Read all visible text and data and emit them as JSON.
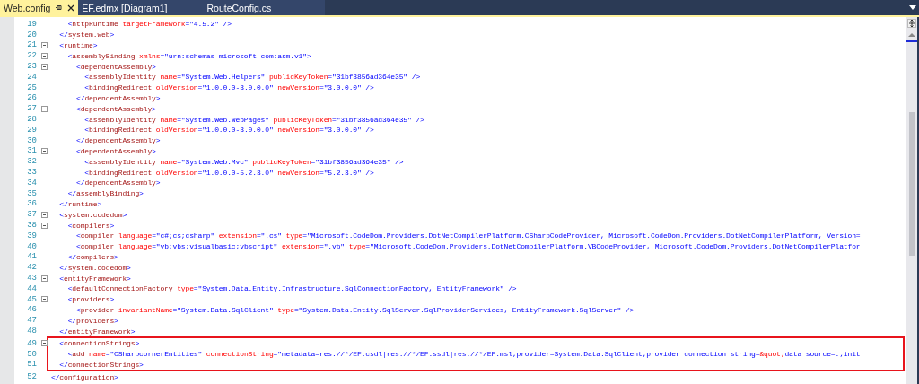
{
  "tabs": [
    {
      "label": "Web.config",
      "selected": true
    },
    {
      "label": "EF.edmx [Diagram1]",
      "selected": false
    },
    {
      "label": "RouteConfig.cs",
      "selected": false
    }
  ],
  "editor": {
    "lines": [
      {
        "number": "19",
        "fold": false,
        "highlighted": false,
        "tokens": [
          {
            "kind": "punct",
            "text": "    <"
          },
          {
            "kind": "elem",
            "text": "httpRuntime"
          },
          {
            "kind": "attr",
            "text": " targetFramework"
          },
          {
            "kind": "value",
            "text": "=\"4.5.2\""
          },
          {
            "kind": "punct",
            "text": " />"
          }
        ]
      },
      {
        "number": "20",
        "fold": false,
        "highlighted": false,
        "tokens": [
          {
            "kind": "punct",
            "text": "  </"
          },
          {
            "kind": "elem",
            "text": "system.web"
          },
          {
            "kind": "punct",
            "text": ">"
          }
        ]
      },
      {
        "number": "21",
        "fold": true,
        "highlighted": false,
        "tokens": [
          {
            "kind": "punct",
            "text": "  <"
          },
          {
            "kind": "elem",
            "text": "runtime"
          },
          {
            "kind": "punct",
            "text": ">"
          }
        ]
      },
      {
        "number": "22",
        "fold": true,
        "highlighted": false,
        "tokens": [
          {
            "kind": "punct",
            "text": "    <"
          },
          {
            "kind": "elem",
            "text": "assemblyBinding"
          },
          {
            "kind": "attr",
            "text": " xmlns"
          },
          {
            "kind": "value",
            "text": "=\"urn:schemas-microsoft-com:asm.v1\""
          },
          {
            "kind": "punct",
            "text": ">"
          }
        ]
      },
      {
        "number": "23",
        "fold": true,
        "highlighted": false,
        "tokens": [
          {
            "kind": "punct",
            "text": "      <"
          },
          {
            "kind": "elem",
            "text": "dependentAssembly"
          },
          {
            "kind": "punct",
            "text": ">"
          }
        ]
      },
      {
        "number": "24",
        "fold": false,
        "highlighted": false,
        "tokens": [
          {
            "kind": "punct",
            "text": "        <"
          },
          {
            "kind": "elem",
            "text": "assemblyIdentity"
          },
          {
            "kind": "attr",
            "text": " name"
          },
          {
            "kind": "value",
            "text": "=\"System.Web.Helpers\""
          },
          {
            "kind": "attr",
            "text": " publicKeyToken"
          },
          {
            "kind": "value",
            "text": "=\"31bf3856ad364e35\""
          },
          {
            "kind": "punct",
            "text": " />"
          }
        ]
      },
      {
        "number": "25",
        "fold": false,
        "highlighted": false,
        "tokens": [
          {
            "kind": "punct",
            "text": "        <"
          },
          {
            "kind": "elem",
            "text": "bindingRedirect"
          },
          {
            "kind": "attr",
            "text": " oldVersion"
          },
          {
            "kind": "value",
            "text": "=\"1.0.0.0-3.0.0.0\""
          },
          {
            "kind": "attr",
            "text": " newVersion"
          },
          {
            "kind": "value",
            "text": "=\"3.0.0.0\""
          },
          {
            "kind": "punct",
            "text": " />"
          }
        ]
      },
      {
        "number": "26",
        "fold": false,
        "highlighted": false,
        "tokens": [
          {
            "kind": "punct",
            "text": "      </"
          },
          {
            "kind": "elem",
            "text": "dependentAssembly"
          },
          {
            "kind": "punct",
            "text": ">"
          }
        ]
      },
      {
        "number": "27",
        "fold": true,
        "highlighted": false,
        "tokens": [
          {
            "kind": "punct",
            "text": "      <"
          },
          {
            "kind": "elem",
            "text": "dependentAssembly"
          },
          {
            "kind": "punct",
            "text": ">"
          }
        ]
      },
      {
        "number": "28",
        "fold": false,
        "highlighted": false,
        "tokens": [
          {
            "kind": "punct",
            "text": "        <"
          },
          {
            "kind": "elem",
            "text": "assemblyIdentity"
          },
          {
            "kind": "attr",
            "text": " name"
          },
          {
            "kind": "value",
            "text": "=\"System.Web.WebPages\""
          },
          {
            "kind": "attr",
            "text": " publicKeyToken"
          },
          {
            "kind": "value",
            "text": "=\"31bf3856ad364e35\""
          },
          {
            "kind": "punct",
            "text": " />"
          }
        ]
      },
      {
        "number": "29",
        "fold": false,
        "highlighted": false,
        "tokens": [
          {
            "kind": "punct",
            "text": "        <"
          },
          {
            "kind": "elem",
            "text": "bindingRedirect"
          },
          {
            "kind": "attr",
            "text": " oldVersion"
          },
          {
            "kind": "value",
            "text": "=\"1.0.0.0-3.0.0.0\""
          },
          {
            "kind": "attr",
            "text": " newVersion"
          },
          {
            "kind": "value",
            "text": "=\"3.0.0.0\""
          },
          {
            "kind": "punct",
            "text": " />"
          }
        ]
      },
      {
        "number": "30",
        "fold": false,
        "highlighted": false,
        "tokens": [
          {
            "kind": "punct",
            "text": "      </"
          },
          {
            "kind": "elem",
            "text": "dependentAssembly"
          },
          {
            "kind": "punct",
            "text": ">"
          }
        ]
      },
      {
        "number": "31",
        "fold": true,
        "highlighted": false,
        "tokens": [
          {
            "kind": "punct",
            "text": "      <"
          },
          {
            "kind": "elem",
            "text": "dependentAssembly"
          },
          {
            "kind": "punct",
            "text": ">"
          }
        ]
      },
      {
        "number": "32",
        "fold": false,
        "highlighted": false,
        "tokens": [
          {
            "kind": "punct",
            "text": "        <"
          },
          {
            "kind": "elem",
            "text": "assemblyIdentity"
          },
          {
            "kind": "attr",
            "text": " name"
          },
          {
            "kind": "value",
            "text": "=\"System.Web.Mvc\""
          },
          {
            "kind": "attr",
            "text": " publicKeyToken"
          },
          {
            "kind": "value",
            "text": "=\"31bf3856ad364e35\""
          },
          {
            "kind": "punct",
            "text": " />"
          }
        ]
      },
      {
        "number": "33",
        "fold": false,
        "highlighted": false,
        "tokens": [
          {
            "kind": "punct",
            "text": "        <"
          },
          {
            "kind": "elem",
            "text": "bindingRedirect"
          },
          {
            "kind": "attr",
            "text": " oldVersion"
          },
          {
            "kind": "value",
            "text": "=\"1.0.0.0-5.2.3.0\""
          },
          {
            "kind": "attr",
            "text": " newVersion"
          },
          {
            "kind": "value",
            "text": "=\"5.2.3.0\""
          },
          {
            "kind": "punct",
            "text": " />"
          }
        ]
      },
      {
        "number": "34",
        "fold": false,
        "highlighted": false,
        "tokens": [
          {
            "kind": "punct",
            "text": "      </"
          },
          {
            "kind": "elem",
            "text": "dependentAssembly"
          },
          {
            "kind": "punct",
            "text": ">"
          }
        ]
      },
      {
        "number": "35",
        "fold": false,
        "highlighted": false,
        "tokens": [
          {
            "kind": "punct",
            "text": "    </"
          },
          {
            "kind": "elem",
            "text": "assemblyBinding"
          },
          {
            "kind": "punct",
            "text": ">"
          }
        ]
      },
      {
        "number": "36",
        "fold": false,
        "highlighted": false,
        "tokens": [
          {
            "kind": "punct",
            "text": "  </"
          },
          {
            "kind": "elem",
            "text": "runtime"
          },
          {
            "kind": "punct",
            "text": ">"
          }
        ]
      },
      {
        "number": "37",
        "fold": true,
        "highlighted": false,
        "tokens": [
          {
            "kind": "punct",
            "text": "  <"
          },
          {
            "kind": "elem",
            "text": "system.codedom"
          },
          {
            "kind": "punct",
            "text": ">"
          }
        ]
      },
      {
        "number": "38",
        "fold": true,
        "highlighted": false,
        "tokens": [
          {
            "kind": "punct",
            "text": "    <"
          },
          {
            "kind": "elem",
            "text": "compilers"
          },
          {
            "kind": "punct",
            "text": ">"
          }
        ]
      },
      {
        "number": "39",
        "fold": false,
        "highlighted": false,
        "tokens": [
          {
            "kind": "punct",
            "text": "      <"
          },
          {
            "kind": "elem",
            "text": "compiler"
          },
          {
            "kind": "attr",
            "text": " language"
          },
          {
            "kind": "value",
            "text": "=\"c#;cs;csharp\""
          },
          {
            "kind": "attr",
            "text": " extension"
          },
          {
            "kind": "value",
            "text": "=\".cs\""
          },
          {
            "kind": "attr",
            "text": " type"
          },
          {
            "kind": "value",
            "text": "=\"Microsoft.CodeDom.Providers.DotNetCompilerPlatform.CSharpCodeProvider, Microsoft.CodeDom.Providers.DotNetCompilerPlatform, Version="
          }
        ]
      },
      {
        "number": "40",
        "fold": false,
        "highlighted": false,
        "tokens": [
          {
            "kind": "punct",
            "text": "      <"
          },
          {
            "kind": "elem",
            "text": "compiler"
          },
          {
            "kind": "attr",
            "text": " language"
          },
          {
            "kind": "value",
            "text": "=\"vb;vbs;visualbasic;vbscript\""
          },
          {
            "kind": "attr",
            "text": " extension"
          },
          {
            "kind": "value",
            "text": "=\".vb\""
          },
          {
            "kind": "attr",
            "text": " type"
          },
          {
            "kind": "value",
            "text": "=\"Microsoft.CodeDom.Providers.DotNetCompilerPlatform.VBCodeProvider, Microsoft.CodeDom.Providers.DotNetCompilerPlatfor"
          }
        ]
      },
      {
        "number": "41",
        "fold": false,
        "highlighted": false,
        "tokens": [
          {
            "kind": "punct",
            "text": "    </"
          },
          {
            "kind": "elem",
            "text": "compilers"
          },
          {
            "kind": "punct",
            "text": ">"
          }
        ]
      },
      {
        "number": "42",
        "fold": false,
        "highlighted": false,
        "tokens": [
          {
            "kind": "punct",
            "text": "  </"
          },
          {
            "kind": "elem",
            "text": "system.codedom"
          },
          {
            "kind": "punct",
            "text": ">"
          }
        ]
      },
      {
        "number": "43",
        "fold": true,
        "highlighted": false,
        "tokens": [
          {
            "kind": "punct",
            "text": "  <"
          },
          {
            "kind": "elem",
            "text": "entityFramework"
          },
          {
            "kind": "punct",
            "text": ">"
          }
        ]
      },
      {
        "number": "44",
        "fold": false,
        "highlighted": false,
        "tokens": [
          {
            "kind": "punct",
            "text": "    <"
          },
          {
            "kind": "elem",
            "text": "defaultConnectionFactory"
          },
          {
            "kind": "attr",
            "text": " type"
          },
          {
            "kind": "value",
            "text": "=\"System.Data.Entity.Infrastructure.SqlConnectionFactory, EntityFramework\""
          },
          {
            "kind": "punct",
            "text": " />"
          }
        ]
      },
      {
        "number": "45",
        "fold": true,
        "highlighted": false,
        "tokens": [
          {
            "kind": "punct",
            "text": "    <"
          },
          {
            "kind": "elem",
            "text": "providers"
          },
          {
            "kind": "punct",
            "text": ">"
          }
        ]
      },
      {
        "number": "46",
        "fold": false,
        "highlighted": false,
        "tokens": [
          {
            "kind": "punct",
            "text": "      <"
          },
          {
            "kind": "elem",
            "text": "provider"
          },
          {
            "kind": "attr",
            "text": " invariantName"
          },
          {
            "kind": "value",
            "text": "=\"System.Data.SqlClient\""
          },
          {
            "kind": "attr",
            "text": " type"
          },
          {
            "kind": "value",
            "text": "=\"System.Data.Entity.SqlServer.SqlProviderServices, EntityFramework.SqlServer\""
          },
          {
            "kind": "punct",
            "text": " />"
          }
        ]
      },
      {
        "number": "47",
        "fold": false,
        "highlighted": false,
        "tokens": [
          {
            "kind": "punct",
            "text": "    </"
          },
          {
            "kind": "elem",
            "text": "providers"
          },
          {
            "kind": "punct",
            "text": ">"
          }
        ]
      },
      {
        "number": "48",
        "fold": false,
        "highlighted": false,
        "tokens": [
          {
            "kind": "punct",
            "text": "  </"
          },
          {
            "kind": "elem",
            "text": "entityFramework"
          },
          {
            "kind": "punct",
            "text": ">"
          }
        ]
      },
      {
        "number": "49",
        "fold": true,
        "highlighted": true,
        "tokens": [
          {
            "kind": "punct",
            "text": "  <"
          },
          {
            "kind": "elem",
            "text": "connectionStrings"
          },
          {
            "kind": "punct",
            "text": ">"
          }
        ]
      },
      {
        "number": "50",
        "fold": false,
        "highlighted": true,
        "tokens": [
          {
            "kind": "punct",
            "text": "    <"
          },
          {
            "kind": "elem",
            "text": "add"
          },
          {
            "kind": "attr",
            "text": " name"
          },
          {
            "kind": "value",
            "text": "=\"CSharpcornerEntities\""
          },
          {
            "kind": "attr",
            "text": " connectionString"
          },
          {
            "kind": "value",
            "text": "=\"metadata=res://*/EF.csdl|res://*/EF.ssdl|res://*/EF.msl;provider=System.Data.SqlClient;provider connection string="
          },
          {
            "kind": "entity",
            "text": "&quot;"
          },
          {
            "kind": "value",
            "text": "data source=.;init"
          }
        ]
      },
      {
        "number": "51",
        "fold": false,
        "highlighted": true,
        "tokens": [
          {
            "kind": "punct",
            "text": "  </"
          },
          {
            "kind": "elem",
            "text": "connectionStrings"
          },
          {
            "kind": "punct",
            "text": ">"
          }
        ]
      },
      {
        "number": "52",
        "fold": false,
        "highlighted": false,
        "tokens": [
          {
            "kind": "punct",
            "text": "</"
          },
          {
            "kind": "elem",
            "text": "configuration"
          },
          {
            "kind": "punct",
            "text": ">"
          }
        ]
      }
    ]
  }
}
